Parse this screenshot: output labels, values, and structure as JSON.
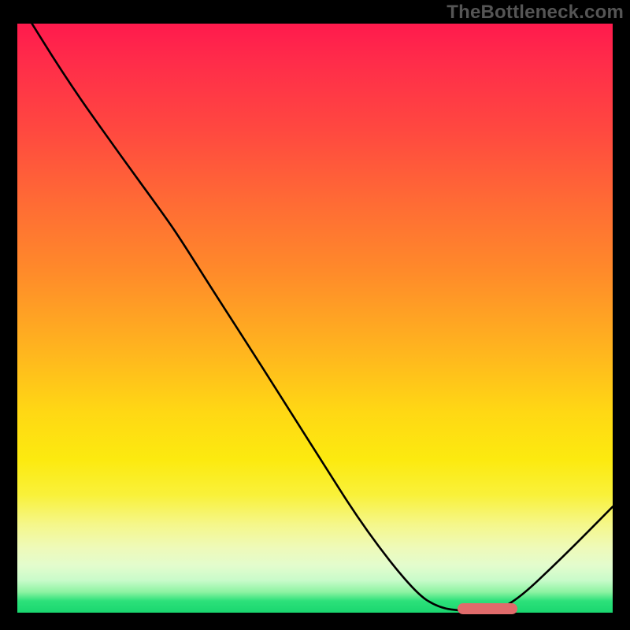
{
  "watermark": "TheBottleneck.com",
  "colors": {
    "marker": "#e06b6b",
    "curve": "#000000"
  },
  "chart_data": {
    "type": "line",
    "title": "",
    "xlabel": "",
    "ylabel": "",
    "xlim": [
      0,
      1
    ],
    "ylim": [
      0,
      1
    ],
    "x": [
      0.0,
      0.083,
      0.167,
      0.25,
      0.278,
      0.333,
      0.417,
      0.5,
      0.583,
      0.667,
      0.708,
      0.75,
      0.792,
      0.833,
      0.917,
      1.0
    ],
    "values": [
      1.04,
      0.905,
      0.785,
      0.67,
      0.628,
      0.54,
      0.408,
      0.275,
      0.143,
      0.035,
      0.008,
      0.003,
      0.003,
      0.015,
      0.095,
      0.18
    ],
    "marker": {
      "x0": 0.74,
      "x1": 0.84,
      "y": 0.0065
    }
  }
}
